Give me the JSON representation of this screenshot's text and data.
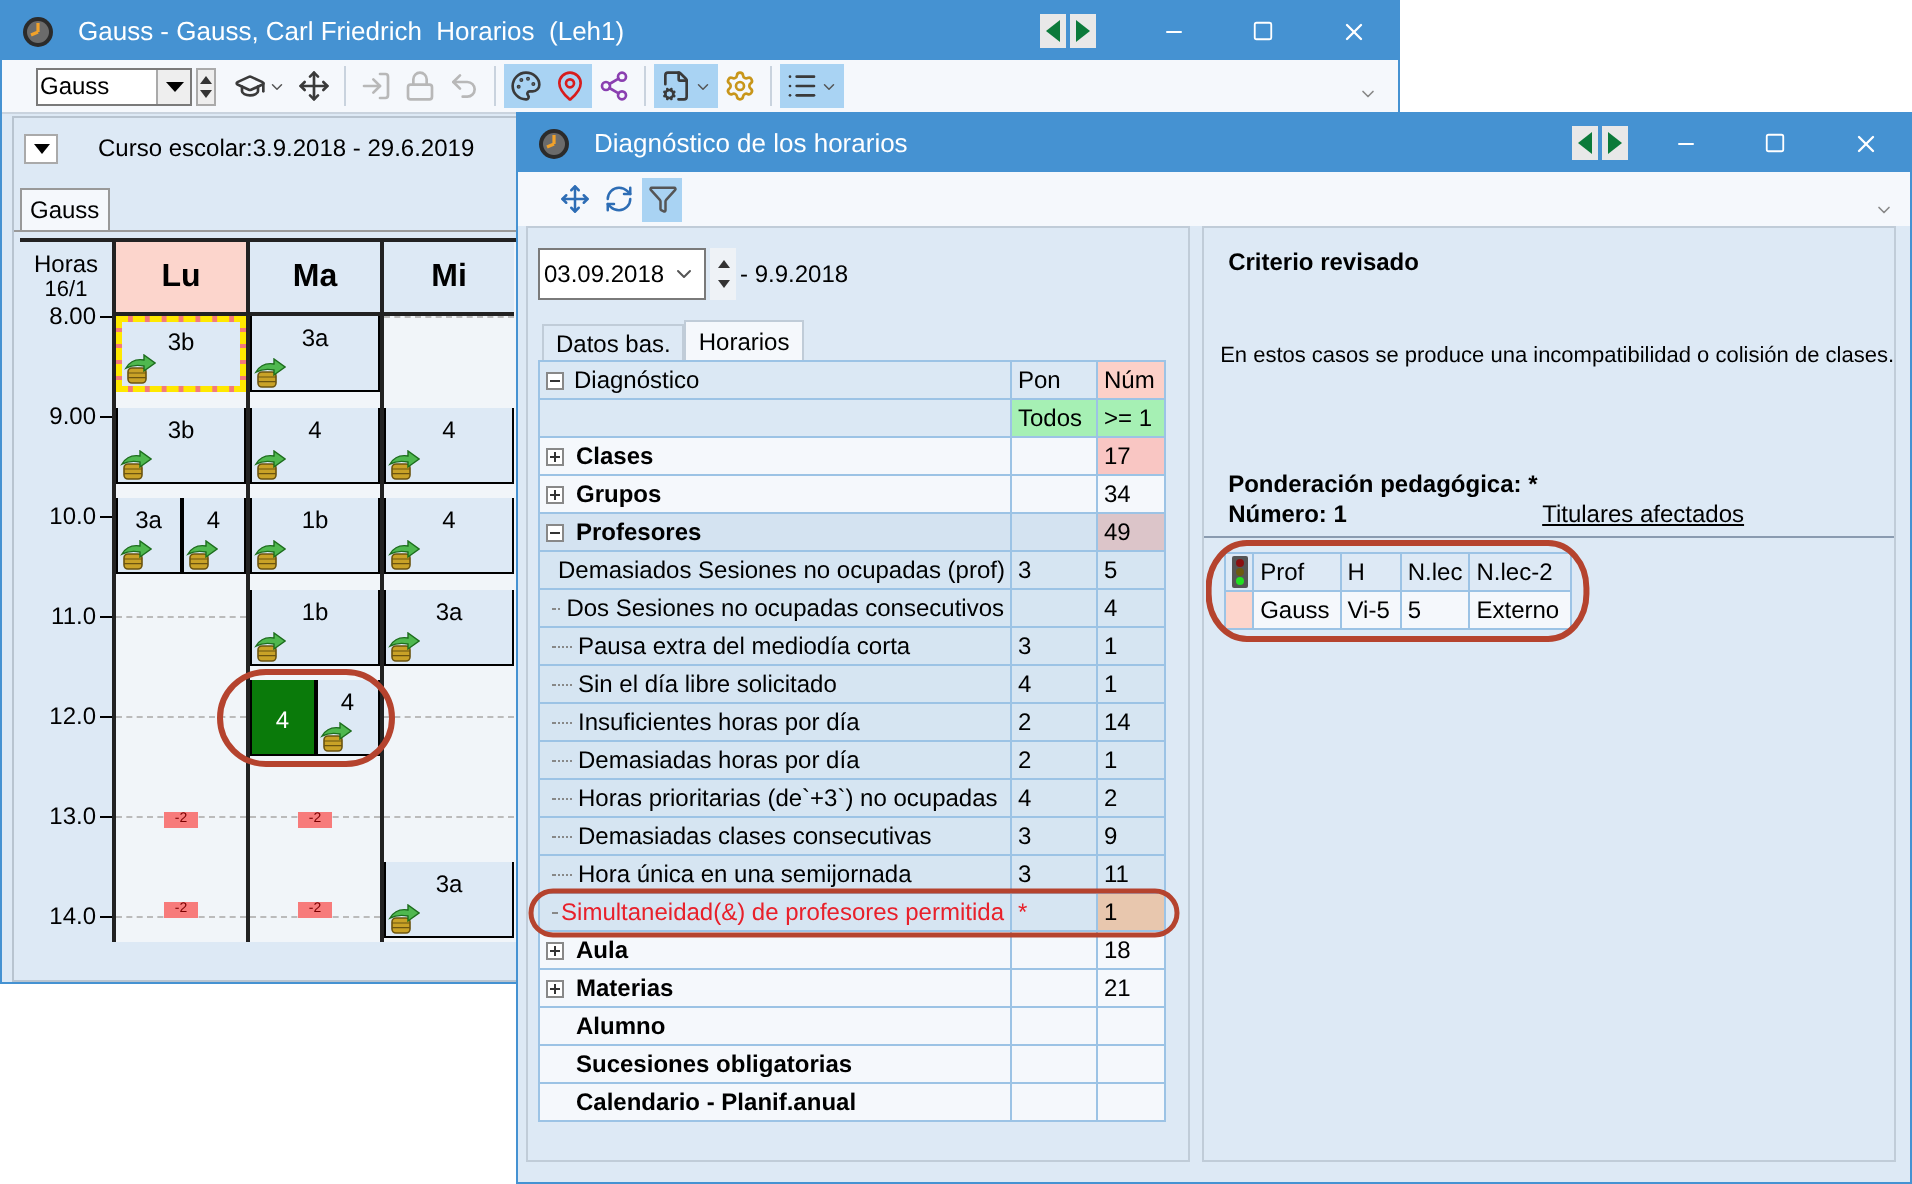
{
  "back_window": {
    "title": "Gauss - Gauss, Carl Friedrich  Horarios  (Leh1)",
    "toolbar": {
      "combo": "Gauss",
      "buttons": [
        {
          "kind": "cap-menu",
          "selected": false,
          "disabled": false
        },
        {
          "kind": "grid",
          "selected": false,
          "disabled": false
        },
        {
          "kind": "enter",
          "selected": false,
          "disabled": true
        },
        {
          "kind": "lock",
          "selected": false,
          "disabled": true
        },
        {
          "kind": "undo",
          "selected": false,
          "disabled": true
        },
        {
          "kind": "palette",
          "selected": true,
          "disabled": false
        },
        {
          "kind": "pin",
          "selected": true,
          "disabled": false
        },
        {
          "kind": "nodes",
          "selected": false,
          "disabled": false
        },
        {
          "kind": "doc-gear-menu",
          "selected": true,
          "disabled": false
        },
        {
          "kind": "gear",
          "selected": false,
          "disabled": false
        },
        {
          "kind": "list-menu",
          "selected": true,
          "disabled": false
        }
      ]
    },
    "school_year": "Curso escolar:3.9.2018 - 29.6.2019",
    "tabs": [
      {
        "label": "Gauss",
        "selected": true
      }
    ],
    "timetable": {
      "corner": "Horas",
      "week": "16/1",
      "hours": [
        "8.00",
        "9.00",
        "10.0",
        "11.0",
        "12.0",
        "13.0",
        "14.0"
      ],
      "days": [
        {
          "label": "Lu",
          "selected": true,
          "periods": [
            {
              "kind": "lessons",
              "lessons": [
                {
                  "label": "3b",
                  "kind": "highlighted"
                }
              ]
            },
            {
              "kind": "lessons",
              "lessons": [
                {
                  "label": "3b",
                  "kind": "normal"
                }
              ]
            },
            {
              "kind": "lessons",
              "lessons": [
                {
                  "label": "3a",
                  "kind": "normal"
                },
                {
                  "label": "4",
                  "kind": "normal"
                }
              ]
            },
            {
              "kind": "free"
            },
            {
              "kind": "free"
            },
            {
              "kind": "mark",
              "mark": "-2"
            },
            {
              "kind": "mark",
              "mark": "-2"
            }
          ]
        },
        {
          "label": "Ma",
          "selected": false,
          "periods": [
            {
              "kind": "lessons",
              "lessons": [
                {
                  "label": "3a",
                  "kind": "normal"
                }
              ]
            },
            {
              "kind": "lessons",
              "lessons": [
                {
                  "label": "4",
                  "kind": "normal"
                }
              ]
            },
            {
              "kind": "lessons",
              "lessons": [
                {
                  "label": "1b",
                  "kind": "normal"
                }
              ]
            },
            {
              "kind": "lessons",
              "lessons": [
                {
                  "label": "1b",
                  "kind": "normal"
                }
              ]
            },
            {
              "kind": "lessons",
              "lessons": [
                {
                  "label": "4",
                  "kind": "conflict"
                },
                {
                  "label": "4",
                  "kind": "normal"
                }
              ]
            },
            {
              "kind": "mark",
              "mark": "-2"
            },
            {
              "kind": "mark",
              "mark": "-2"
            }
          ]
        },
        {
          "label": "Mi",
          "selected": false,
          "periods": [
            {
              "kind": "free"
            },
            {
              "kind": "lessons",
              "lessons": [
                {
                  "label": "4",
                  "kind": "normal"
                }
              ]
            },
            {
              "kind": "lessons",
              "lessons": [
                {
                  "label": "4",
                  "kind": "normal"
                }
              ]
            },
            {
              "kind": "lessons",
              "lessons": [
                {
                  "label": "3a",
                  "kind": "normal"
                }
              ]
            },
            {
              "kind": "free"
            },
            {
              "kind": "free"
            },
            {
              "kind": "lessons",
              "lessons": [
                {
                  "label": "3a",
                  "kind": "normal"
                }
              ]
            }
          ]
        }
      ]
    }
  },
  "front_window": {
    "title": "Diagnóstico de los horarios",
    "toolbar": [
      {
        "kind": "grid",
        "selected": false
      },
      {
        "kind": "refresh",
        "selected": false
      },
      {
        "kind": "filter",
        "selected": true
      }
    ],
    "date_from": "03.09.2018",
    "date_to": "- 9.9.2018",
    "tabs": [
      {
        "label": "Datos bas.",
        "selected": false
      },
      {
        "label": "Horarios",
        "selected": true
      }
    ],
    "table": {
      "root": {
        "label": "Diagnóstico",
        "expanded": true
      },
      "columns": [
        "Pon",
        "Núm"
      ],
      "filters": [
        "Todos",
        ">= 1"
      ],
      "rows": [
        {
          "label": "Clases",
          "kind": "group",
          "expanded": false,
          "selected": false,
          "num": "17",
          "color": "#f9c6c3"
        },
        {
          "label": "Grupos",
          "kind": "group",
          "expanded": false,
          "selected": false,
          "num": "34"
        },
        {
          "label": "Profesores",
          "kind": "group",
          "expanded": true,
          "selected": false,
          "num": "49",
          "color": "#dcc5c9",
          "children": [
            {
              "label": "Demasiados Sesiones no ocupadas (prof)",
              "pon": "3",
              "num": "5",
              "selected": false
            },
            {
              "label": "Dos Sesiones no ocupadas consecutivos",
              "num": "4",
              "selected": false
            },
            {
              "label": "Pausa extra del mediodía corta",
              "pon": "3",
              "num": "1",
              "selected": false
            },
            {
              "label": "Sin el día libre solicitado",
              "pon": "4",
              "num": "1",
              "selected": false
            },
            {
              "label": "Insuficientes horas por día",
              "pon": "2",
              "num": "14",
              "selected": false
            },
            {
              "label": "Demasiadas horas por día",
              "pon": "2",
              "num": "1",
              "selected": false
            },
            {
              "label": "Horas prioritarias (de`+3`) no ocupadas",
              "pon": "4",
              "num": "2",
              "selected": false
            },
            {
              "label": "Demasiadas clases consecutivas",
              "pon": "3",
              "num": "9",
              "selected": false
            },
            {
              "label": "Hora única en una semijornada",
              "pon": "3",
              "num": "11",
              "selected": false
            },
            {
              "label": "Simultaneidad(&) de profesores permitida",
              "pon": "*",
              "num": "1",
              "selected": true,
              "color": "#e8c7ae"
            }
          ]
        },
        {
          "label": "Aula",
          "kind": "group",
          "expanded": false,
          "selected": false,
          "num": "18"
        },
        {
          "label": "Materias",
          "kind": "group",
          "expanded": false,
          "selected": false,
          "num": "21"
        },
        {
          "label": "Alumno",
          "kind": "heading",
          "selected": false
        },
        {
          "label": "Sucesiones obligatorias",
          "kind": "heading",
          "selected": false
        },
        {
          "label": "Calendario - Planif.anual",
          "kind": "heading",
          "selected": false
        }
      ]
    },
    "criterion": {
      "title": "Criterio revisado",
      "description": "En estos casos se produce una incompatibilidad o colisión de clases.",
      "weight": "Ponderación pedagógica: *",
      "count": "Número: 1",
      "link": "Titulares afectados",
      "affected": {
        "columns": [
          "Prof",
          "H",
          "N.lec",
          "N.lec-2"
        ],
        "rows": [
          [
            "Gauss",
            "Vi-5",
            "5",
            "Externo"
          ]
        ]
      }
    }
  }
}
